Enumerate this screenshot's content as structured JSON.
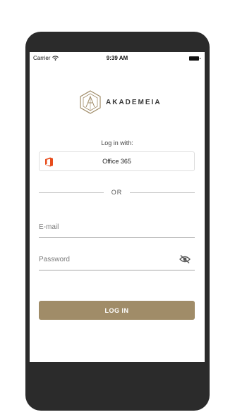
{
  "status_bar": {
    "carrier": "Carrier",
    "time": "9:39 AM"
  },
  "brand": {
    "name": "AKADEMEIA"
  },
  "login": {
    "login_with_label": "Log in with:",
    "office365_label": "Office 365",
    "or_label": "OR",
    "email_placeholder": "E-mail",
    "password_placeholder": "Password",
    "login_button_label": "LOG IN"
  },
  "colors": {
    "accent": "#a08c68",
    "office_red": "#e74c1c",
    "phone_frame": "#2b2b2b"
  }
}
